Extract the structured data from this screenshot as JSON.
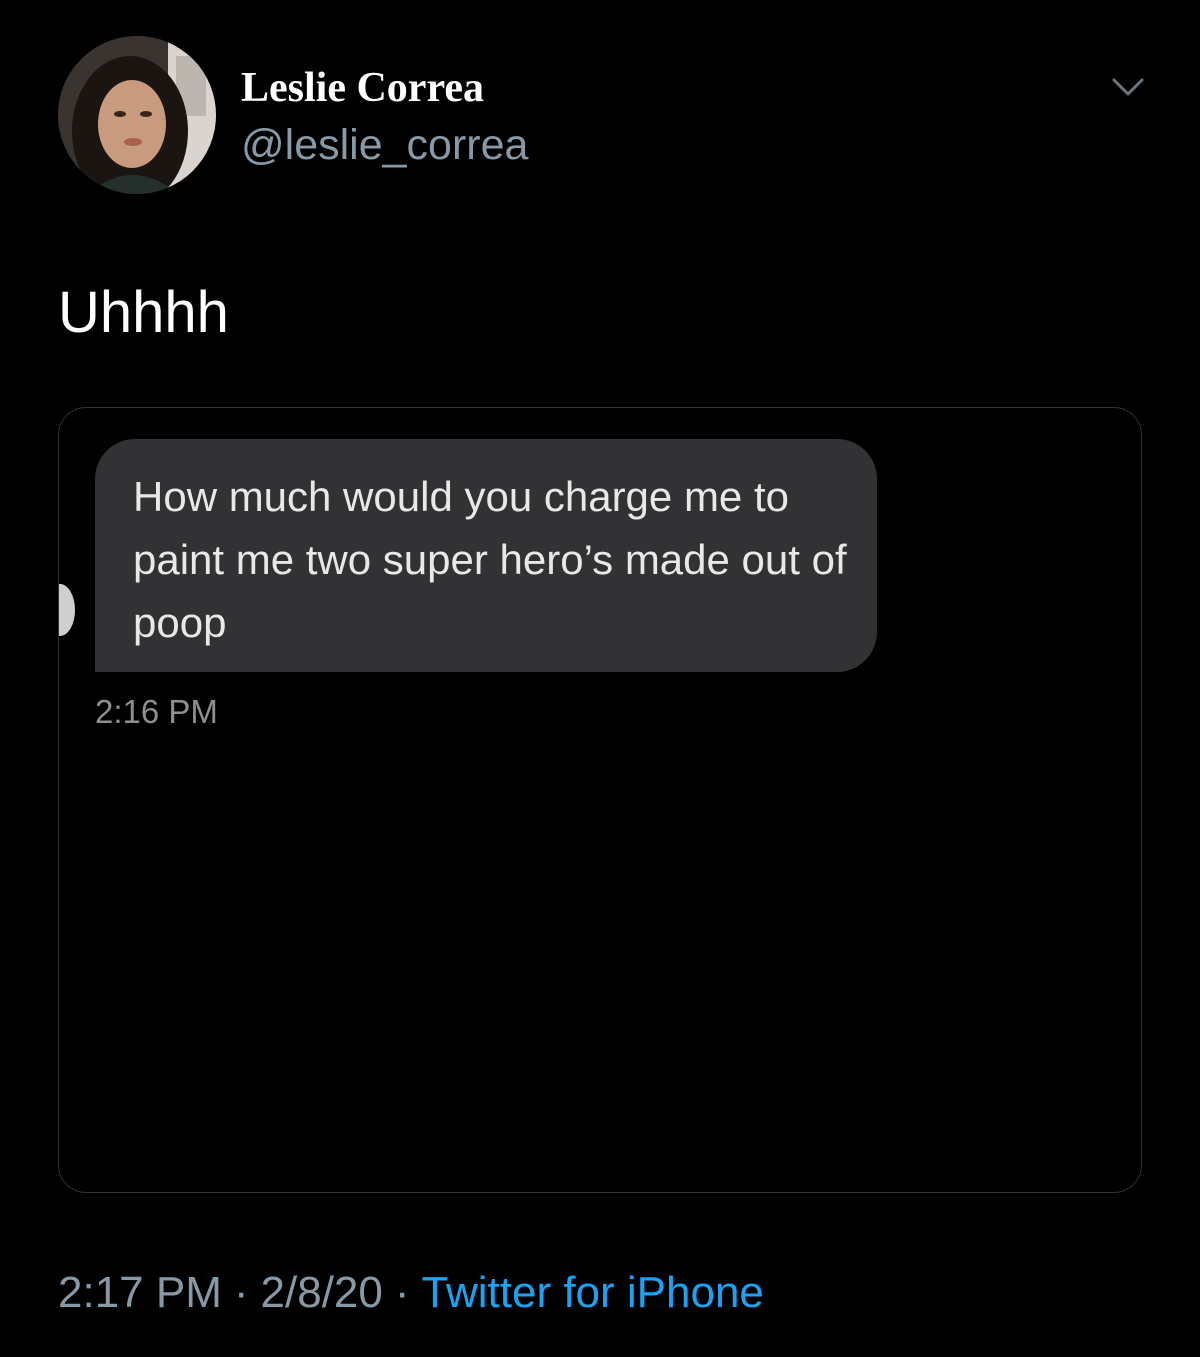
{
  "author": {
    "display_name": "Leslie Correa",
    "handle": "@leslie_correa",
    "avatar_icon": "profile-photo"
  },
  "tweet": {
    "text": "Uhhhh"
  },
  "media": {
    "message_text": "How much would you charge me to paint me two super hero’s made out of poop",
    "message_time": "2:16 PM",
    "bubble_color": "#323235"
  },
  "meta": {
    "time": "2:17 PM",
    "separator": "·",
    "date": "2/8/20",
    "source": "Twitter for iPhone",
    "source_color": "#1da1f2"
  },
  "icons": {
    "menu": "chevron-down-icon"
  }
}
